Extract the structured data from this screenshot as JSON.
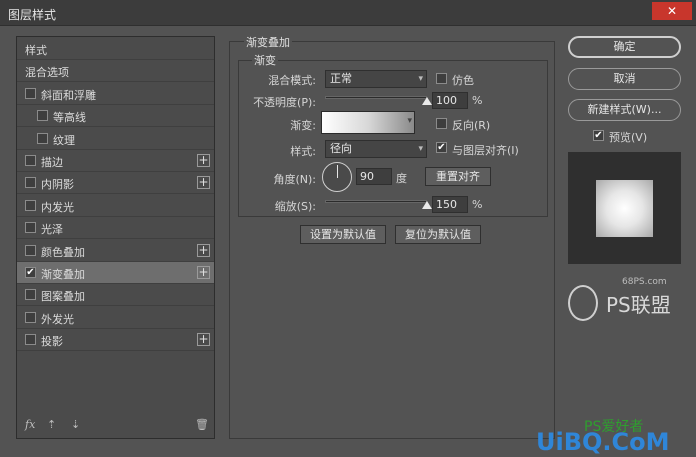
{
  "window": {
    "title": "图层样式",
    "close": "✕"
  },
  "styles_list": {
    "items": [
      {
        "label": "样式",
        "checkbox": false,
        "indent": 0,
        "plus": false,
        "checked": false,
        "selected": false
      },
      {
        "label": "混合选项",
        "checkbox": false,
        "indent": 0,
        "plus": false,
        "checked": false,
        "selected": false
      },
      {
        "label": "斜面和浮雕",
        "checkbox": true,
        "indent": 0,
        "plus": false,
        "checked": false,
        "selected": false
      },
      {
        "label": "等高线",
        "checkbox": true,
        "indent": 1,
        "plus": false,
        "checked": false,
        "selected": false
      },
      {
        "label": "纹理",
        "checkbox": true,
        "indent": 1,
        "plus": false,
        "checked": false,
        "selected": false
      },
      {
        "label": "描边",
        "checkbox": true,
        "indent": 0,
        "plus": true,
        "checked": false,
        "selected": false
      },
      {
        "label": "内阴影",
        "checkbox": true,
        "indent": 0,
        "plus": true,
        "checked": false,
        "selected": false
      },
      {
        "label": "内发光",
        "checkbox": true,
        "indent": 0,
        "plus": false,
        "checked": false,
        "selected": false
      },
      {
        "label": "光泽",
        "checkbox": true,
        "indent": 0,
        "plus": false,
        "checked": false,
        "selected": false
      },
      {
        "label": "颜色叠加",
        "checkbox": true,
        "indent": 0,
        "plus": true,
        "checked": false,
        "selected": false
      },
      {
        "label": "渐变叠加",
        "checkbox": true,
        "indent": 0,
        "plus": true,
        "checked": true,
        "selected": true
      },
      {
        "label": "图案叠加",
        "checkbox": true,
        "indent": 0,
        "plus": false,
        "checked": false,
        "selected": false
      },
      {
        "label": "外发光",
        "checkbox": true,
        "indent": 0,
        "plus": false,
        "checked": false,
        "selected": false
      },
      {
        "label": "投影",
        "checkbox": true,
        "indent": 0,
        "plus": true,
        "checked": false,
        "selected": false
      }
    ],
    "footer": {
      "fx": "fx",
      "up": "⇡",
      "down": "⇣",
      "trash": "🗑"
    }
  },
  "gradient_overlay": {
    "group_title": "渐变叠加",
    "sub_title": "渐变",
    "blend_mode_label": "混合模式:",
    "blend_mode_value": "正常",
    "dither_label": "仿色",
    "opacity_label": "不透明度(P):",
    "opacity_value": "100",
    "opacity_unit": "%",
    "opacity_fraction": 1.0,
    "gradient_label": "渐变:",
    "reverse_label": "反向(R)",
    "style_label": "样式:",
    "style_value": "径向",
    "align_label": "与图层对齐(I)",
    "angle_label": "角度(N):",
    "angle_value": "90",
    "angle_unit": "度",
    "reset_align_button": "重置对齐",
    "scale_label": "缩放(S):",
    "scale_value": "150",
    "scale_unit": "%",
    "scale_fraction": 1.0,
    "set_default_button": "设置为默认值",
    "reset_default_button": "复位为默认值",
    "dropdown_arrow": "▾",
    "check_mark": "✔"
  },
  "right_panel": {
    "ok_button": "确定",
    "cancel_button": "取消",
    "new_style_button": "新建样式(W)...",
    "preview_label": "预览(V)",
    "preview_checked": true
  },
  "watermark": {
    "site": "68PS.com",
    "brand": "PS联盟",
    "bottom": "UiBQ.CoM",
    "bottom_ps": "PS爱好者"
  }
}
